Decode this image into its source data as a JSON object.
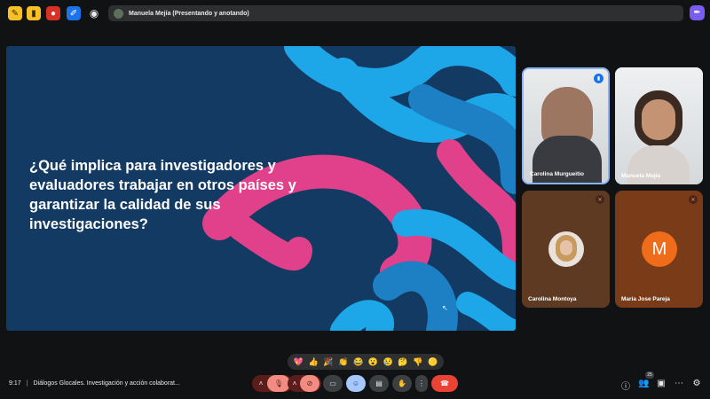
{
  "topbar": {
    "presenter_text": "Manuela Mejía (Presentando y anotando)"
  },
  "slide": {
    "line1": "¿Qué implica para investigadores y",
    "line2": "evaluadores trabajar en otros países y",
    "line3": "garantizar la calidad de sus",
    "line4": "investigaciones?",
    "colors": {
      "background": "#123a63",
      "pink": "#e0418a",
      "light_blue": "#1ea7e8",
      "mid_blue": "#1d7fc4"
    }
  },
  "participants": [
    {
      "name": "Carolina Murgueitio",
      "state": "speaking"
    },
    {
      "name": "Manuela Mejía",
      "state": "video"
    },
    {
      "name": "Carolina Montoya",
      "state": "muted"
    },
    {
      "name": "María Jose Pareja",
      "state": "muted",
      "initial": "M"
    }
  ],
  "reactions": [
    "💖",
    "👍",
    "🎉",
    "👏",
    "😂",
    "😮",
    "😢",
    "🤔",
    "👎",
    "🟡"
  ],
  "bottom": {
    "time": "9:17",
    "meeting_title": "Diálogos Glocales. Investigación y acción colaborat...",
    "participants_count": "25"
  }
}
